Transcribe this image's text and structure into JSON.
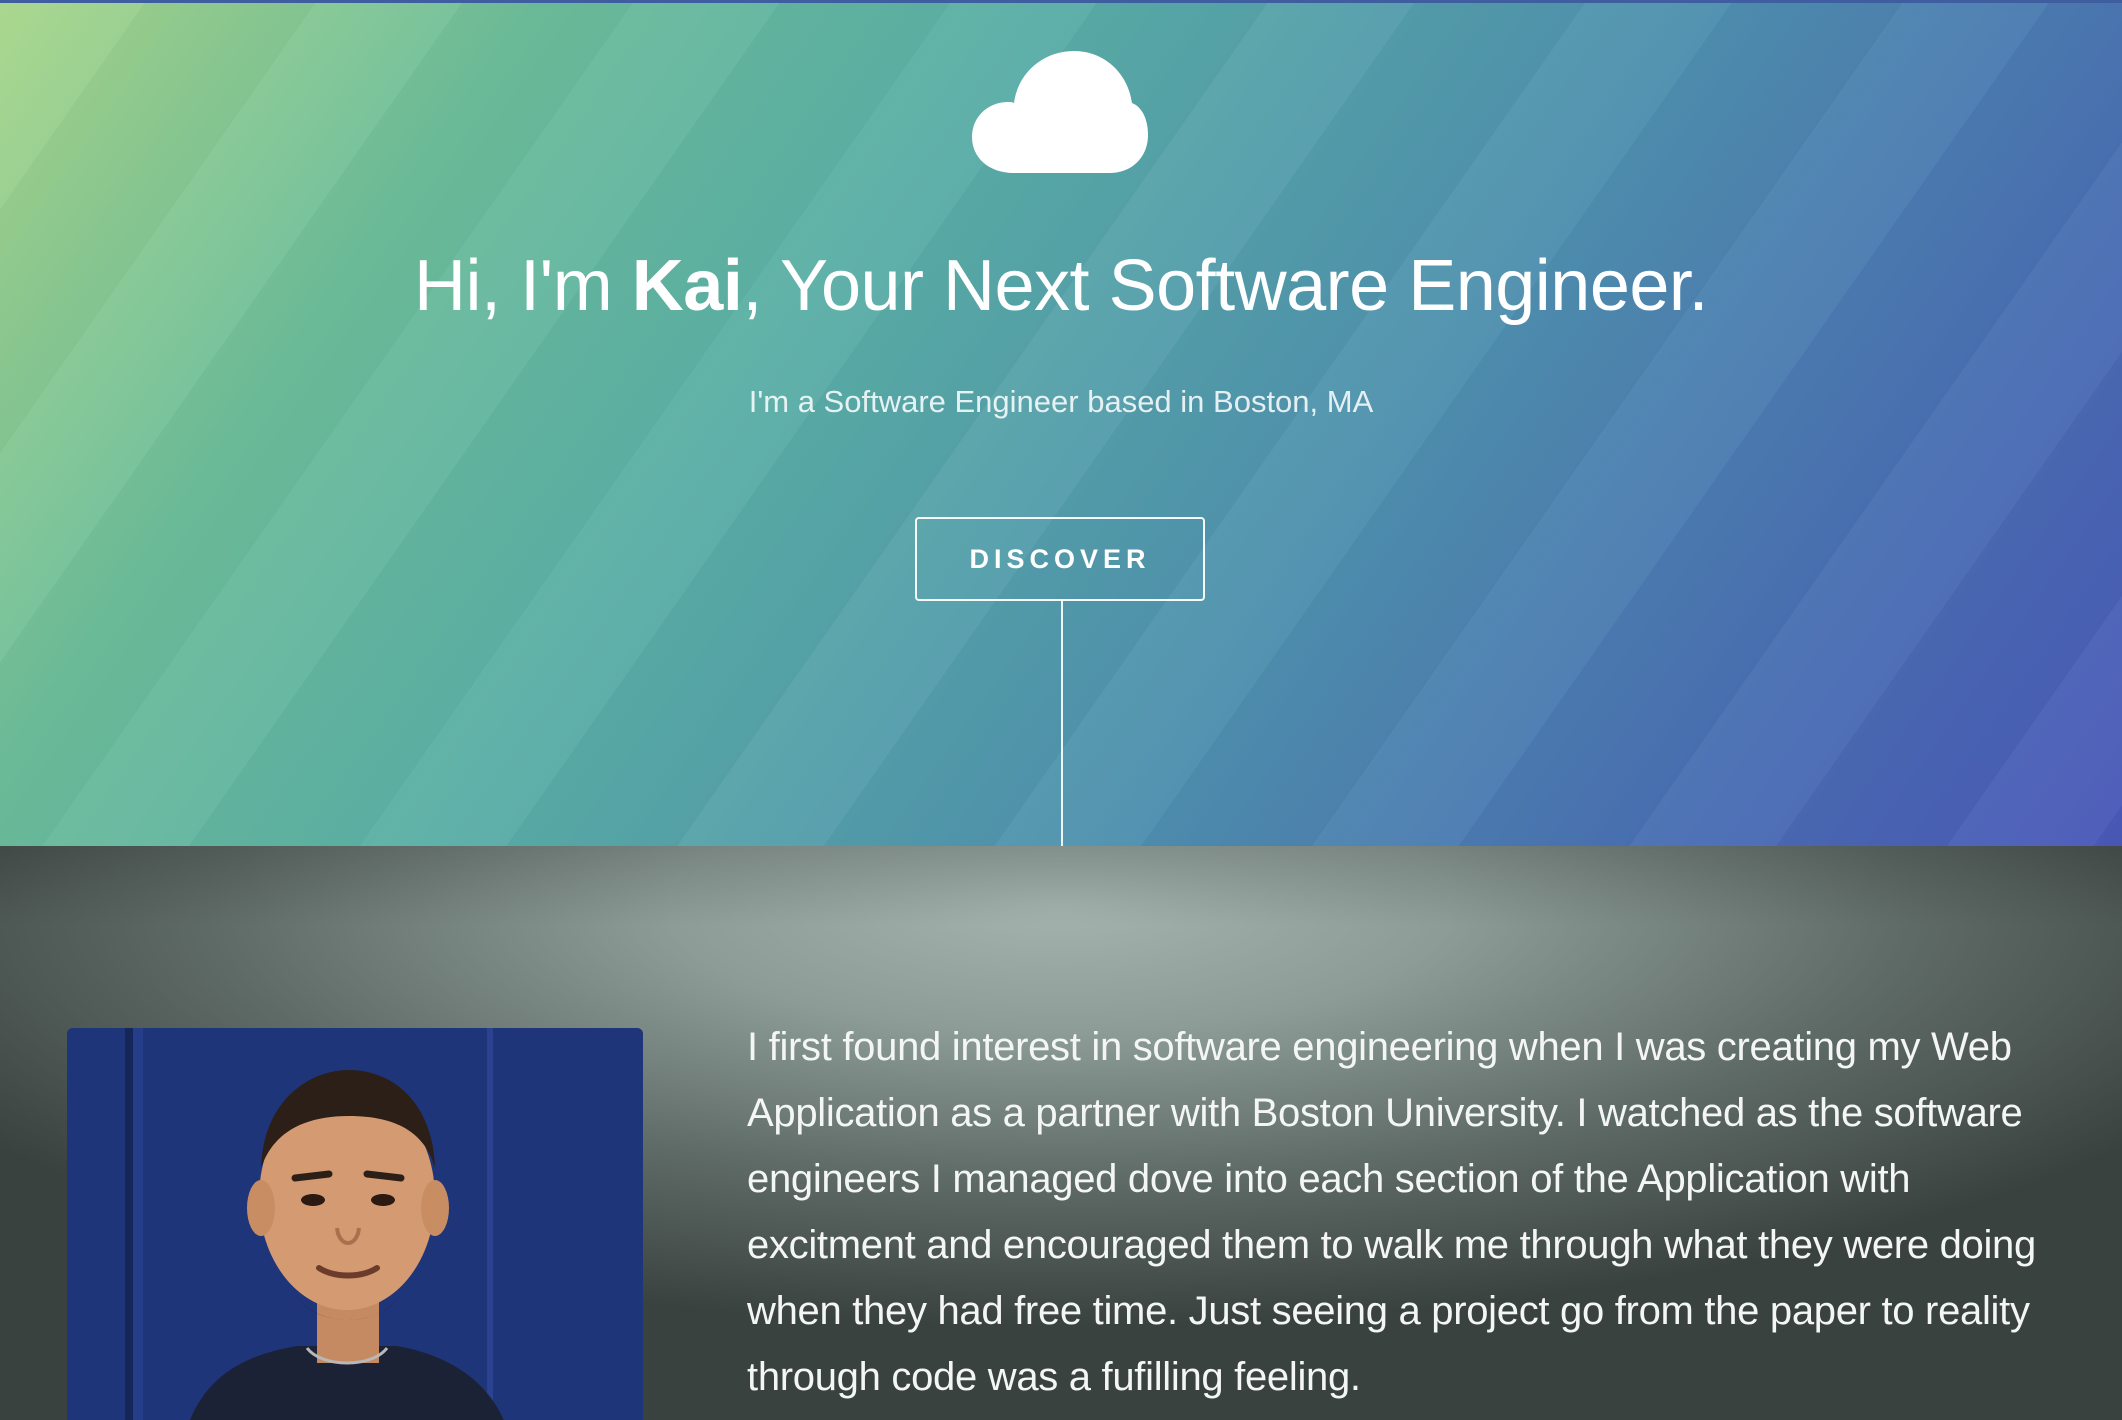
{
  "hero": {
    "icon": "cloud-icon",
    "headline_prefix": "Hi, I'm ",
    "headline_name": "Kai",
    "headline_suffix": ", Your Next Software Engineer.",
    "subtitle": "I'm a Software Engineer based in Boston, MA",
    "discover_label": "DISCOVER"
  },
  "about": {
    "paragraph": "I first found interest in software engineering when I was creating my Web Application as a partner with Boston University. I watched as the software engineers I managed dove into each section of the Application with excitment and encouraged them to walk me through what they were doing when they had free time. Just seeing a project go from the paper to reality through code was a fufilling feeling."
  },
  "colors": {
    "hero_gradient_start": "#a8d68a",
    "hero_gradient_end": "#4a58b8",
    "text": "#ffffff"
  }
}
